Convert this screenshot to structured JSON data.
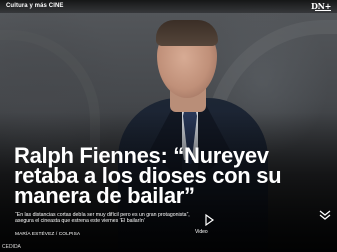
{
  "topbar": {
    "section_parent": "Cultura y más",
    "section_child": "CINE",
    "logo": "DN+"
  },
  "article": {
    "headline": "Ralph Fiennes: “Nureyev retaba a los dioses con su manera de bailar”",
    "lead": "“En las distancias cortas debía ser muy difícil pero es un gran protagonista”, asegura el cineasta que estrena este viernes 'El bailarín'",
    "byline": "MARÍA ESTÉVEZ / COLPISA",
    "photo_credit": "CEDIDA"
  },
  "video": {
    "icon": "play-icon",
    "label": "Video"
  },
  "nav": {
    "next_icon": "chevron-down-icon"
  },
  "colors": {
    "text": "#ffffff",
    "suit": "#1d2635"
  }
}
